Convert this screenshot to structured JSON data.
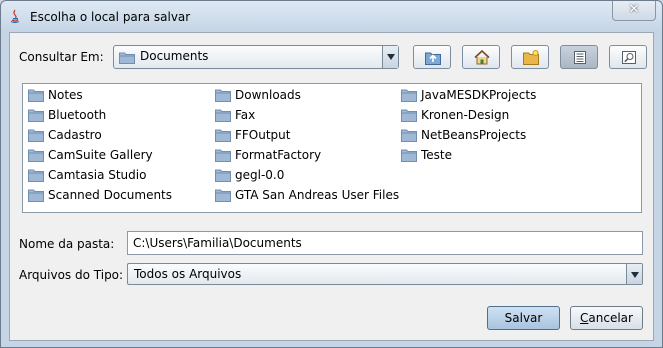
{
  "window": {
    "title": "Escolha o local para salvar",
    "close_symbol": "✕"
  },
  "toolbar": {
    "look_in_label": "Consultar Em:",
    "look_in_value": "Documents",
    "buttons": [
      {
        "name": "up-one-level-button",
        "icon": "folder-up-icon"
      },
      {
        "name": "home-button",
        "icon": "home-icon"
      },
      {
        "name": "new-folder-button",
        "icon": "new-folder-icon"
      },
      {
        "name": "list-view-button",
        "icon": "list-view-icon",
        "active": true
      },
      {
        "name": "details-view-button",
        "icon": "details-view-icon"
      }
    ]
  },
  "files": {
    "col1": [
      "Notes",
      "Bluetooth",
      "Cadastro",
      "CamSuite Gallery",
      "Camtasia Studio",
      "Scanned Documents"
    ],
    "col2": [
      "Downloads",
      "Fax",
      "FFOutput",
      "FormatFactory",
      "gegl-0.0",
      "GTA San Andreas User Files"
    ],
    "col3": [
      "JavaMESDKProjects",
      "Kronen-Design",
      "NetBeansProjects",
      "Teste"
    ]
  },
  "form": {
    "folder_name_label": "Nome da pasta:",
    "folder_name_value": "C:\\Users\\Familia\\Documents",
    "file_type_label": "Arquivos do Tipo:",
    "file_type_value": "Todos os Arquivos"
  },
  "actions": {
    "save_label": "Salvar",
    "cancel_first": "C",
    "cancel_rest": "ancelar"
  },
  "colors": {
    "folder": "#9fb8d6",
    "folder_dark": "#6f8fb3",
    "title_bg": "#d6e2ef"
  }
}
